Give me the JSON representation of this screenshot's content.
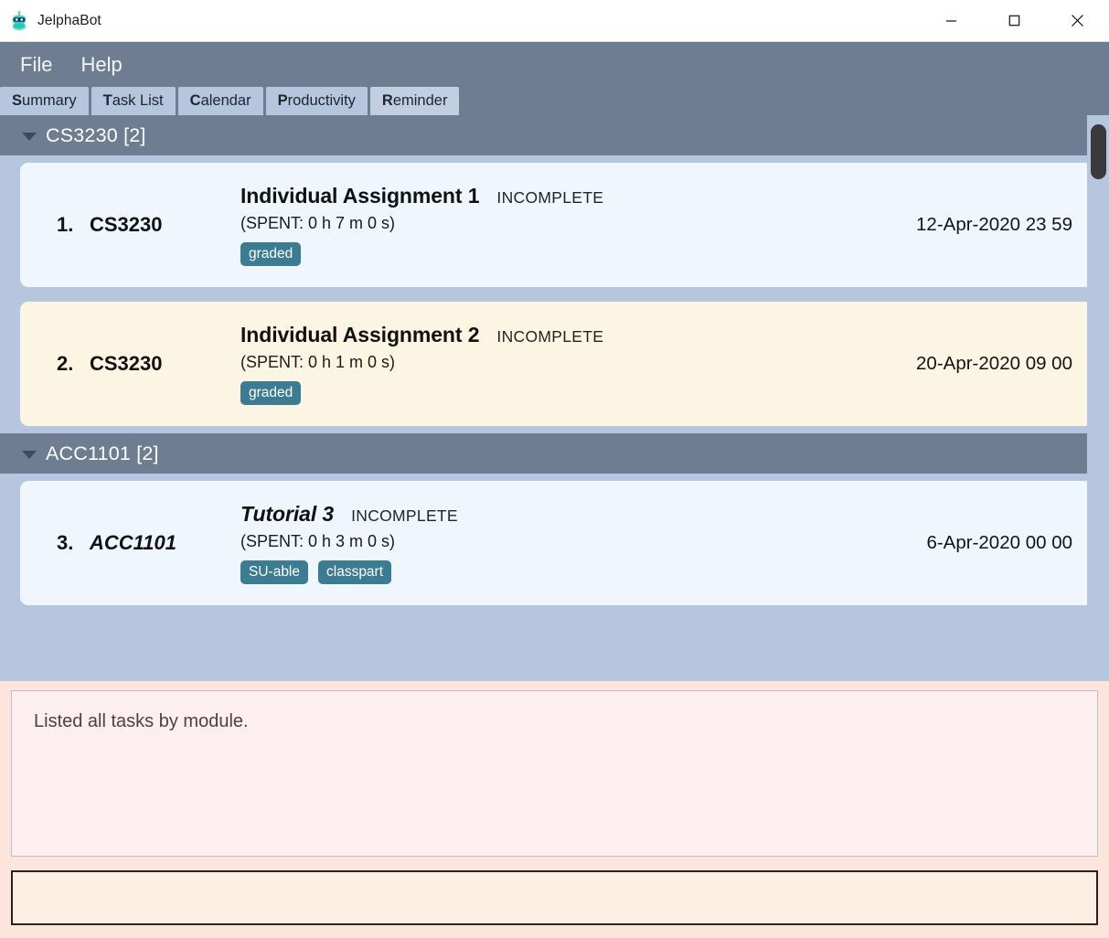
{
  "window": {
    "title": "JelphaBot",
    "icon": "robot-icon",
    "controls": {
      "minimize": "minimize-icon",
      "maximize": "maximize-icon",
      "close": "close-icon"
    }
  },
  "menubar": {
    "items": [
      {
        "label": "File"
      },
      {
        "label": "Help"
      }
    ]
  },
  "tabs": [
    {
      "mnemonic": "S",
      "rest": "ummary",
      "selected": false
    },
    {
      "mnemonic": "T",
      "rest": "ask List",
      "selected": false
    },
    {
      "mnemonic": "C",
      "rest": "alendar",
      "selected": false
    },
    {
      "mnemonic": "P",
      "rest": "roductivity",
      "selected": false
    },
    {
      "mnemonic": "R",
      "rest": "eminder",
      "selected": true
    }
  ],
  "groups": [
    {
      "title": "CS3230 [2]",
      "caret": "chevron-down-icon",
      "tasks": [
        {
          "index": "1.",
          "module": "CS3230",
          "title": "Individual Assignment 1",
          "status": "INCOMPLETE",
          "spent": "(SPENT: 0 h 7 m 0 s)",
          "tags": [
            "graded"
          ],
          "date": "12-Apr-2020 23 59",
          "theme": "blue",
          "italic": false
        },
        {
          "index": "2.",
          "module": "CS3230",
          "title": "Individual Assignment 2",
          "status": "INCOMPLETE",
          "spent": "(SPENT: 0 h 1 m 0 s)",
          "tags": [
            "graded"
          ],
          "date": "20-Apr-2020 09 00",
          "theme": "cream",
          "italic": false
        }
      ]
    },
    {
      "title": "ACC1101 [2]",
      "caret": "chevron-down-icon",
      "tasks": [
        {
          "index": "3.",
          "module": "ACC1101",
          "title": "Tutorial 3",
          "status": "INCOMPLETE",
          "spent": "(SPENT: 0 h 3 m 0 s)",
          "tags": [
            "SU-able",
            "classpart"
          ],
          "date": "6-Apr-2020 00 00",
          "theme": "blue",
          "italic": true
        }
      ]
    }
  ],
  "result": {
    "text": "Listed all tasks by module."
  },
  "command": {
    "value": "",
    "placeholder": ""
  },
  "colors": {
    "menubar": "#6e7d91",
    "tab": "#b6c6de",
    "tab_selected": "#c2cfe2",
    "group_header": "#6e7d91",
    "card_blue": "#eff6fe",
    "card_cream": "#fdf5e3",
    "tag": "#3c7c93",
    "result_bg": "#fdeef0",
    "bottom_bg": "#fde4dc",
    "command_bg": "#fdeee2"
  }
}
